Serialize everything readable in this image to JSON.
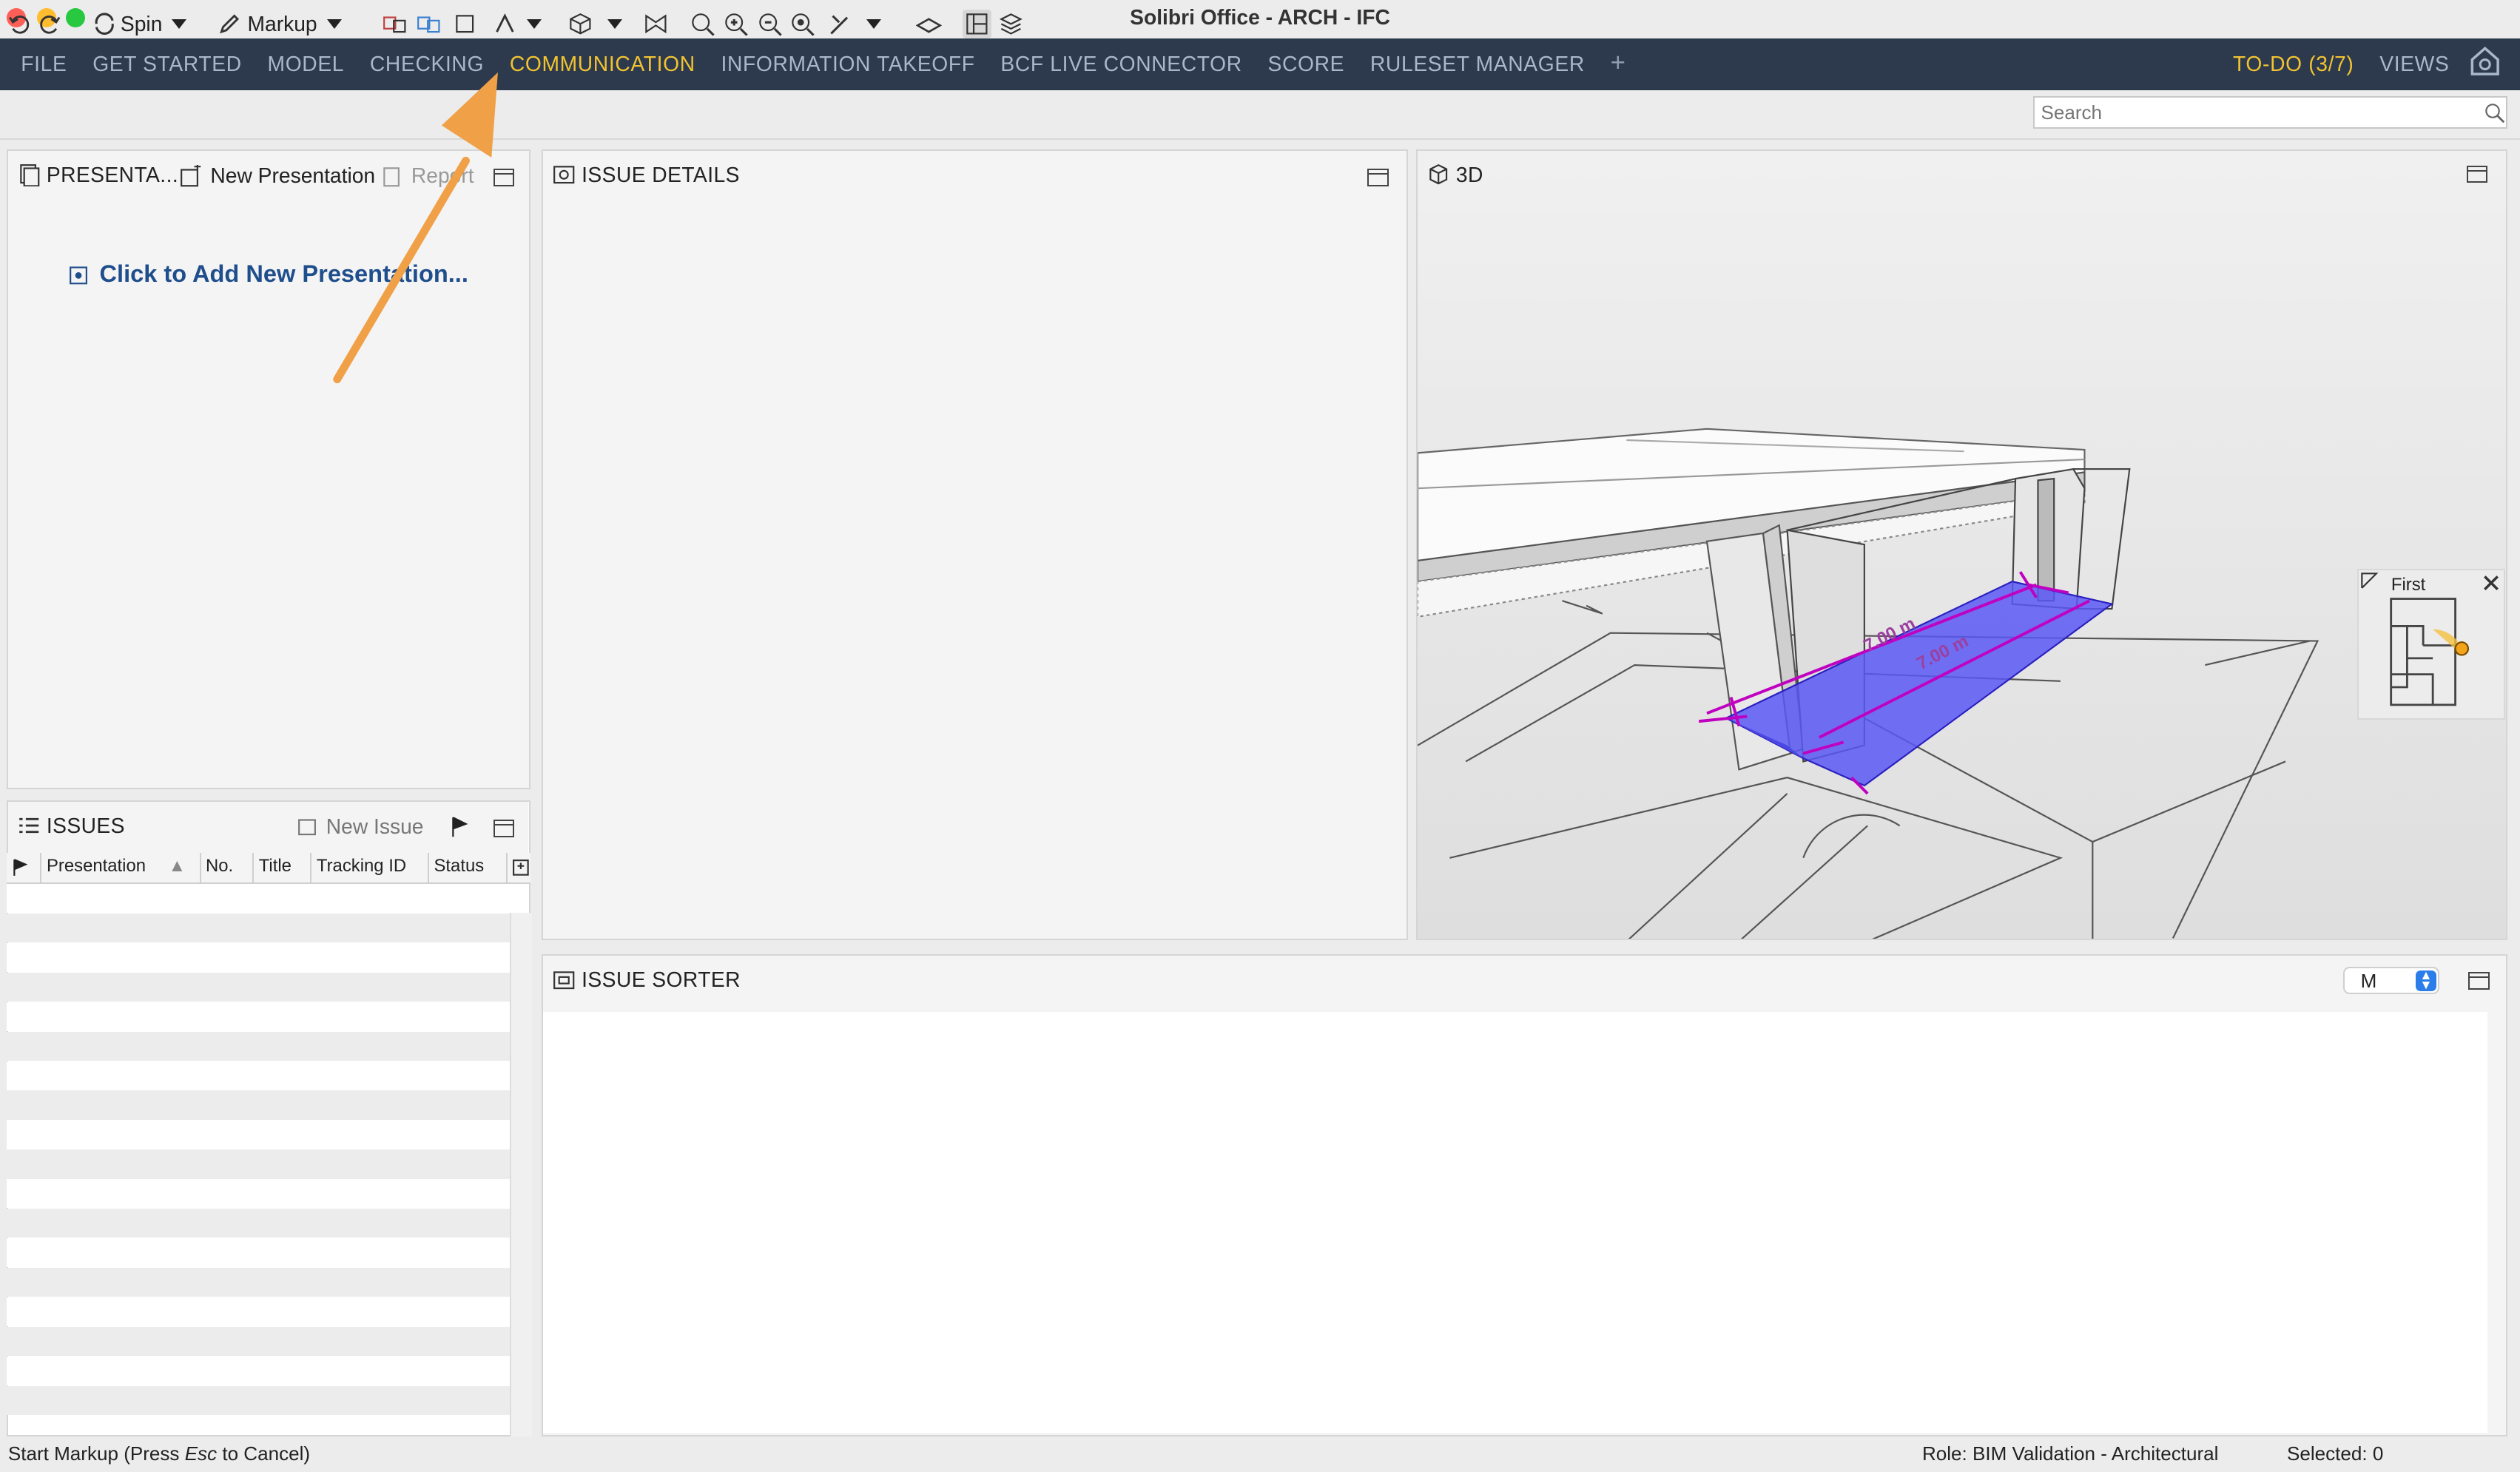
{
  "window": {
    "title": "Solibri Office - ARCH - IFC"
  },
  "menu": {
    "items": [
      "FILE",
      "GET STARTED",
      "MODEL",
      "CHECKING",
      "COMMUNICATION",
      "INFORMATION TAKEOFF",
      "BCF LIVE CONNECTOR",
      "SCORE",
      "RULESET MANAGER"
    ],
    "active": "COMMUNICATION",
    "plus": "+",
    "todo": "TO-DO (3/7)",
    "views": "VIEWS"
  },
  "toolbar": {
    "spin_label": "Spin",
    "markup_label": "Markup",
    "search_placeholder": "Search"
  },
  "presentations": {
    "title": "PRESENTA...",
    "new_label": "New Presentation",
    "report_label": "Report",
    "add_link": "Click to Add New Presentation..."
  },
  "issues": {
    "title": "ISSUES",
    "new_issue": "New Issue",
    "columns": [
      "Presentation",
      "No.",
      "Title",
      "Tracking ID",
      "Status"
    ]
  },
  "issue_details": {
    "title": "ISSUE DETAILS"
  },
  "view3d": {
    "title": "3D",
    "minimap_label": "First",
    "dim_label_1": "7.00 m",
    "dim_label_2": "7.00 m"
  },
  "issue_sorter": {
    "title": "ISSUE SORTER",
    "select_value": "M"
  },
  "status": {
    "hint_prefix": "Start Markup (Press ",
    "hint_key": "Esc",
    "hint_suffix": " to Cancel)",
    "role": "Role: BIM Validation - Architectural",
    "selected": "Selected: 0"
  },
  "colors": {
    "menubar_bg": "#2d3a4e",
    "menu_text": "#a9b7ca",
    "active_accent": "#f2c330",
    "link_blue": "#1f4e8c",
    "arrow_orange": "#f0a046",
    "markup_purple": "#6a5cff"
  }
}
